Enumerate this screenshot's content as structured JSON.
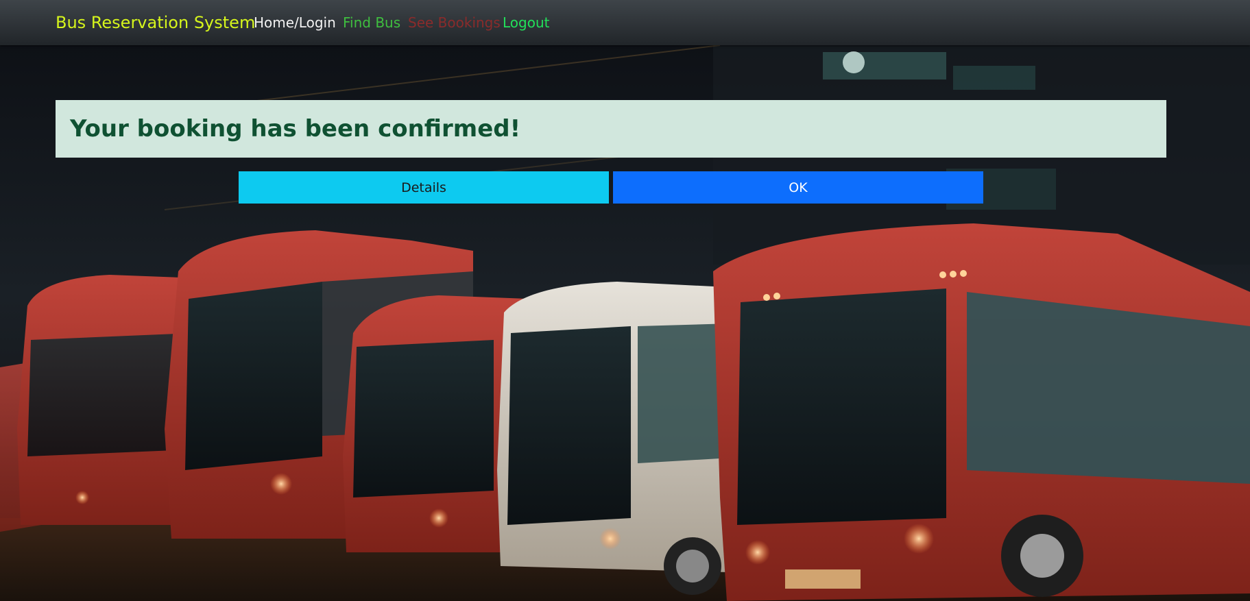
{
  "navbar": {
    "brand": "Bus Reservation System",
    "links": [
      {
        "label": "Home/Login",
        "color": "#f2f2f2"
      },
      {
        "label": "Find Bus",
        "color": "#3fbf3f"
      },
      {
        "label": "See Bookings",
        "color": "#8a2b2b"
      },
      {
        "label": "Logout",
        "color": "#22e05a"
      }
    ],
    "brand_color": "#d6f51c"
  },
  "alert": {
    "message": "Your booking has been confirmed!",
    "background": "#d1e7dd",
    "text_color": "#0f5132"
  },
  "actions": {
    "details_label": "Details",
    "ok_label": "OK",
    "details_color": "#0dcaf0",
    "ok_color": "#0d6efd"
  }
}
